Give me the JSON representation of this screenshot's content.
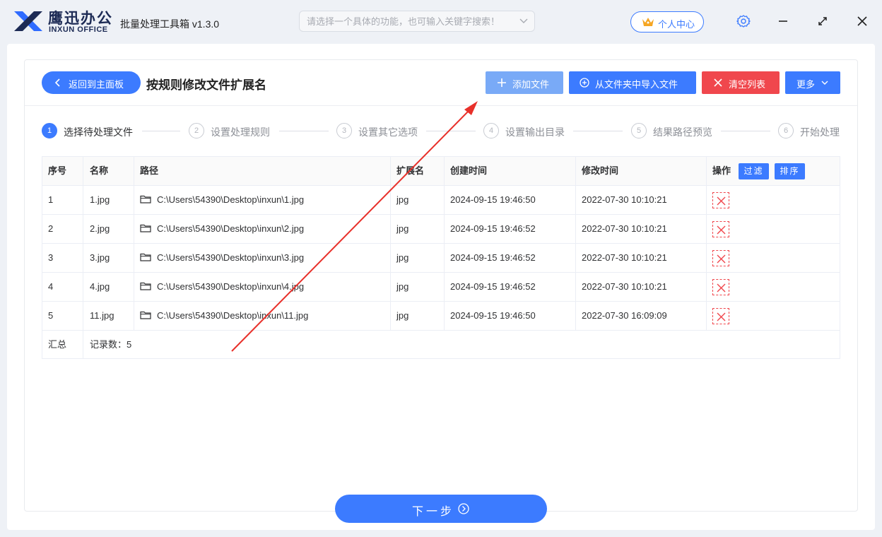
{
  "app": {
    "brand_cn": "鹰迅办公",
    "brand_en": "INXUN OFFICE",
    "title": "批量处理工具箱 v1.3.0",
    "search_placeholder": "请选择一个具体的功能，也可输入关键字搜索！",
    "personal_center": "个人中心"
  },
  "toolbar": {
    "back_label": "返回到主面板",
    "page_title": "按规则修改文件扩展名",
    "add_file": "添加文件",
    "import_folder": "从文件夹中导入文件",
    "clear_list": "清空列表",
    "more": "更多"
  },
  "steps": [
    {
      "num": "1",
      "label": "选择待处理文件",
      "active": true
    },
    {
      "num": "2",
      "label": "设置处理规则",
      "active": false
    },
    {
      "num": "3",
      "label": "设置其它选项",
      "active": false
    },
    {
      "num": "4",
      "label": "设置输出目录",
      "active": false
    },
    {
      "num": "5",
      "label": "结果路径预览",
      "active": false
    },
    {
      "num": "6",
      "label": "开始处理",
      "active": false
    }
  ],
  "table": {
    "headers": {
      "index": "序号",
      "name": "名称",
      "path": "路径",
      "ext": "扩展名",
      "created": "创建时间",
      "modified": "修改时间",
      "ops": "操作",
      "filter": "过滤",
      "sort": "排序"
    },
    "rows": [
      {
        "index": "1",
        "name": "1.jpg",
        "path": "C:\\Users\\54390\\Desktop\\inxun\\1.jpg",
        "ext": "jpg",
        "created": "2024-09-15 19:46:50",
        "modified": "2022-07-30 10:10:21"
      },
      {
        "index": "2",
        "name": "2.jpg",
        "path": "C:\\Users\\54390\\Desktop\\inxun\\2.jpg",
        "ext": "jpg",
        "created": "2024-09-15 19:46:52",
        "modified": "2022-07-30 10:10:21"
      },
      {
        "index": "3",
        "name": "3.jpg",
        "path": "C:\\Users\\54390\\Desktop\\inxun\\3.jpg",
        "ext": "jpg",
        "created": "2024-09-15 19:46:52",
        "modified": "2022-07-30 10:10:21"
      },
      {
        "index": "4",
        "name": "4.jpg",
        "path": "C:\\Users\\54390\\Desktop\\inxun\\4.jpg",
        "ext": "jpg",
        "created": "2024-09-15 19:46:52",
        "modified": "2022-07-30 10:10:21"
      },
      {
        "index": "5",
        "name": "11.jpg",
        "path": "C:\\Users\\54390\\Desktop\\inxun\\11.jpg",
        "ext": "jpg",
        "created": "2024-09-15 19:46:50",
        "modified": "2022-07-30 16:09:09"
      }
    ],
    "summary": {
      "label": "汇总",
      "count": "记录数：5"
    }
  },
  "footer": {
    "next": "下一步"
  },
  "colors": {
    "primary": "#3c7bff",
    "add_light": "#79aaf7",
    "danger": "#f0474d",
    "annotation_arrow": "#e8302a"
  },
  "icons": [
    "brand-logo-icon",
    "chevron-down-icon",
    "crown-icon",
    "gear-icon",
    "minimize-icon",
    "maximize-icon",
    "close-icon",
    "back-arrow-icon",
    "plus-icon",
    "circle-plus-icon",
    "x-icon",
    "folder-icon",
    "delete-icon",
    "circle-arrow-right-icon"
  ]
}
